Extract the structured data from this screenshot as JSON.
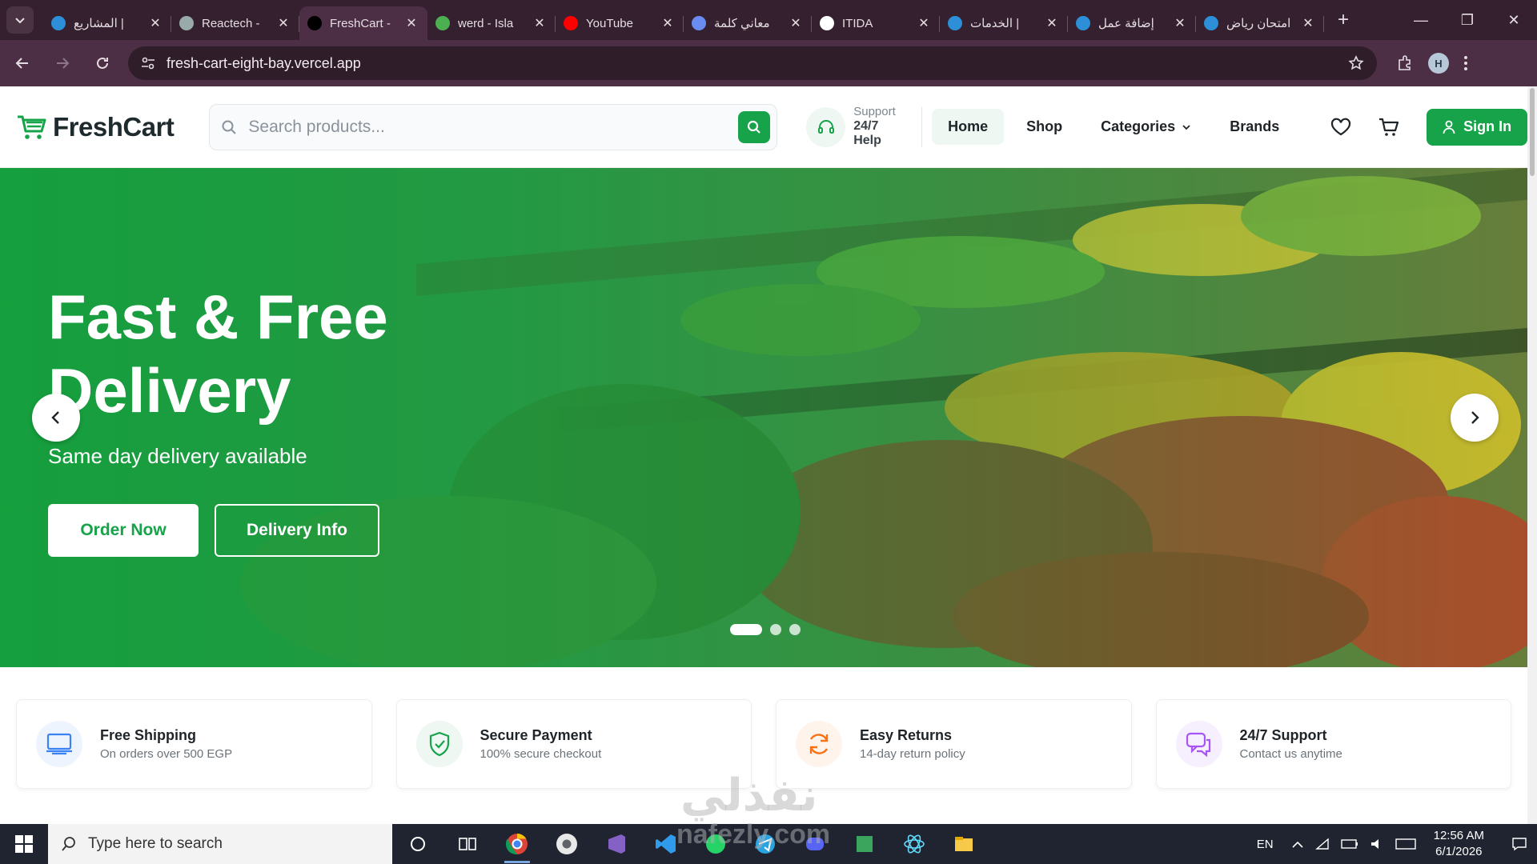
{
  "browser": {
    "tabs": [
      {
        "title": "المشاريع |",
        "active": false,
        "icon": "mostaql-icon"
      },
      {
        "title": "Reactech -",
        "active": false,
        "icon": "globe-icon"
      },
      {
        "title": "FreshCart -",
        "active": true,
        "icon": "vercel-icon"
      },
      {
        "title": "werd - Isla",
        "active": false,
        "icon": "bookmark-icon"
      },
      {
        "title": "YouTube",
        "active": false,
        "icon": "youtube-icon"
      },
      {
        "title": "معاني كلمة",
        "active": false,
        "icon": "gemini-icon"
      },
      {
        "title": "ITIDA",
        "active": false,
        "icon": "itida-icon"
      },
      {
        "title": "الخدمات |",
        "active": false,
        "icon": "mostaql-icon"
      },
      {
        "title": "إضافة عمل",
        "active": false,
        "icon": "mostaql-icon"
      },
      {
        "title": "امتحان رياض",
        "active": false,
        "icon": "mostaql-icon"
      }
    ],
    "url": "fresh-cart-eight-bay.vercel.app",
    "profile_initial": "H"
  },
  "header": {
    "logo_text": "FreshCart",
    "search_placeholder": "Search products...",
    "support_label": "Support",
    "support_value": "24/7 Help",
    "nav": [
      {
        "label": "Home",
        "active": true
      },
      {
        "label": "Shop",
        "active": false
      },
      {
        "label": "Categories",
        "active": false,
        "dropdown": true
      },
      {
        "label": "Brands",
        "active": false
      }
    ],
    "sign_in_label": "Sign In",
    "accent_color": "#16a34a"
  },
  "hero": {
    "title": "Fast & Free Delivery",
    "subtitle": "Same day delivery available",
    "primary_button": "Order Now",
    "secondary_button": "Delivery Info",
    "slide_count": 3,
    "active_slide": 1
  },
  "features": [
    {
      "title": "Free Shipping",
      "subtitle": "On orders over 500 EGP",
      "icon": "truck-icon",
      "color": "#3b82f6",
      "bg": "#eef4fe"
    },
    {
      "title": "Secure Payment",
      "subtitle": "100% secure checkout",
      "icon": "shield-check-icon",
      "color": "#16a34a",
      "bg": "#eef7f1"
    },
    {
      "title": "Easy Returns",
      "subtitle": "14-day return policy",
      "icon": "refresh-icon",
      "color": "#f97316",
      "bg": "#fff4ec"
    },
    {
      "title": "24/7 Support",
      "subtitle": "Contact us anytime",
      "icon": "chat-icon",
      "color": "#a855f7",
      "bg": "#f6effe"
    }
  ],
  "watermark": "nafezly.com",
  "watermark_ar": "نفذلي",
  "taskbar": {
    "search_placeholder": "Type here to search",
    "language": "EN",
    "time": "12:56 AM",
    "date": "6/1/2026"
  }
}
